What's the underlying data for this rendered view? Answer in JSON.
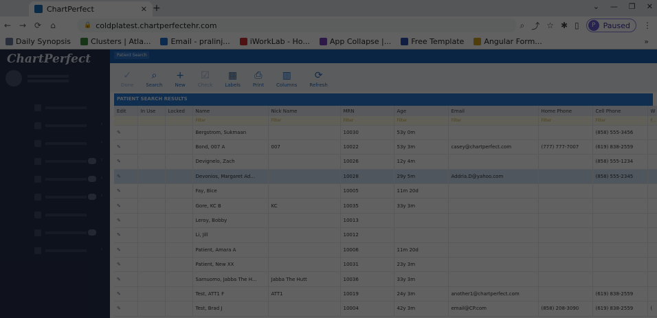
{
  "browser": {
    "tab_title": "ChartPerfect",
    "url": "coldplatest.chartperfectehr.com",
    "profile_initial": "P",
    "profile_status": "Paused",
    "bookmarks": [
      {
        "label": "Daily Synopsis",
        "color": "#6a7d9a"
      },
      {
        "label": "Clusters | Atla...",
        "color": "#3b8c3b"
      },
      {
        "label": "Email - pralinj...",
        "color": "#1e6fd0"
      },
      {
        "label": "iWorkLab - Ho...",
        "color": "#d03030"
      },
      {
        "label": "App Collapse |...",
        "color": "#7a3fc0"
      },
      {
        "label": "Free Template",
        "color": "#2b4fb0"
      },
      {
        "label": "Angular Form...",
        "color": "#d0a020"
      }
    ]
  },
  "app": {
    "logo": "ChartPerfect",
    "module_tab": "Patient Search",
    "toolbar": [
      {
        "icon": "check-icon",
        "glyph": "✓",
        "label": "Done",
        "enabled": false
      },
      {
        "icon": "search-icon",
        "glyph": "⌕",
        "label": "Search",
        "enabled": true
      },
      {
        "icon": "plus-icon",
        "glyph": "+",
        "label": "New",
        "enabled": true
      },
      {
        "icon": "check-icon",
        "glyph": "☑",
        "label": "Check",
        "enabled": false
      },
      {
        "icon": "labels-icon",
        "glyph": "▦",
        "label": "Labels",
        "enabled": true
      },
      {
        "icon": "print-icon",
        "glyph": "⎙",
        "label": "Print",
        "enabled": true
      },
      {
        "icon": "columns-icon",
        "glyph": "▥",
        "label": "Columns",
        "enabled": true
      },
      {
        "icon": "refresh-icon",
        "glyph": "⟳",
        "label": "Refresh",
        "enabled": true
      }
    ],
    "section_title": "PATIENT SEARCH RESULTS",
    "columns": [
      "Edit",
      "In Use",
      "Locked",
      "Name",
      "Nick Name",
      "MRN",
      "Age",
      "Email",
      "Home Phone",
      "Cell Phone",
      "W"
    ],
    "filter_placeholder": "Filter",
    "rows": [
      {
        "name": "Bergstrom, Sukmaan",
        "nick": "",
        "mrn": "10030",
        "age": "53y 0m",
        "email": "",
        "home": "",
        "cell": "(858) 555-3456",
        "w": ""
      },
      {
        "name": "Bond, 007 A",
        "nick": "007",
        "mrn": "10022",
        "age": "53y 3m",
        "email": "casey@chartperfect.com",
        "home": "(777) 777-7007",
        "cell": "(619) 838-2559",
        "w": ""
      },
      {
        "name": "Devignelo, Zach",
        "nick": "",
        "mrn": "10026",
        "age": "12y 4m",
        "email": "",
        "home": "",
        "cell": "(858) 555-1234",
        "w": ""
      },
      {
        "name": "Devonios, Margaret Ad...",
        "nick": "",
        "mrn": "10028",
        "age": "29y 5m",
        "email": "Addria.D@yahoo.com",
        "home": "",
        "cell": "(858) 555-2345",
        "w": ""
      },
      {
        "name": "Fay, Bice",
        "nick": "",
        "mrn": "10005",
        "age": "11m 20d",
        "email": "",
        "home": "",
        "cell": "",
        "w": ""
      },
      {
        "name": "Gore, KC B",
        "nick": "KC",
        "mrn": "10035",
        "age": "33y 3m",
        "email": "",
        "home": "",
        "cell": "",
        "w": ""
      },
      {
        "name": "Leroy, Bobby",
        "nick": "",
        "mrn": "10013",
        "age": "",
        "email": "",
        "home": "",
        "cell": "",
        "w": ""
      },
      {
        "name": "Li, Jill",
        "nick": "",
        "mrn": "10012",
        "age": "",
        "email": "",
        "home": "",
        "cell": "",
        "w": ""
      },
      {
        "name": "Patient, Amara A",
        "nick": "",
        "mrn": "10006",
        "age": "11m 20d",
        "email": "",
        "home": "",
        "cell": "",
        "w": ""
      },
      {
        "name": "Patient, New XX",
        "nick": "",
        "mrn": "10031",
        "age": "23y 3m",
        "email": "",
        "home": "",
        "cell": "",
        "w": ""
      },
      {
        "name": "Sarnuomo, Jabba The H...",
        "nick": "Jabba The Hutt",
        "mrn": "10036",
        "age": "33y 3m",
        "email": "",
        "home": "",
        "cell": "",
        "w": ""
      },
      {
        "name": "Test, ATT1 F",
        "nick": "ATT1",
        "mrn": "10019",
        "age": "24y 3m",
        "email": "another1@chartperfect.com",
        "home": "",
        "cell": "(619) 838-2559",
        "w": ""
      },
      {
        "name": "Test, Brad J",
        "nick": "",
        "mrn": "10004",
        "age": "42y 3m",
        "email": "email@CP.com",
        "home": "(858) 208-3090",
        "cell": "(619) 838-2559",
        "w": "("
      }
    ]
  }
}
